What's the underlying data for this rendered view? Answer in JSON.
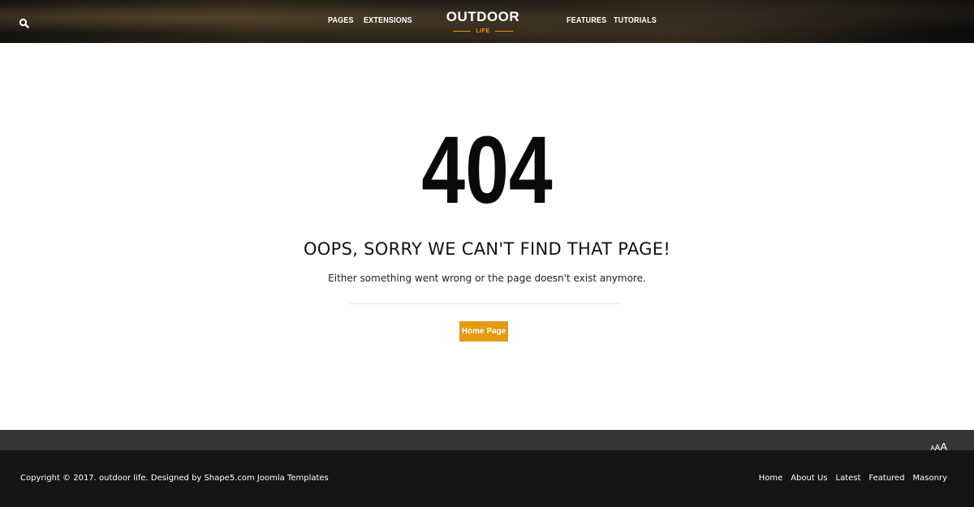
{
  "header": {
    "nav_left": [
      "PAGES",
      "EXTENSIONS"
    ],
    "nav_right": [
      "FEATURES",
      "TUTORIALS"
    ],
    "logo": {
      "main": "OUTDOOR",
      "sub": "LIFE"
    }
  },
  "error": {
    "code": "404",
    "title": "OOPS, SORRY WE CAN'T FIND THAT PAGE!",
    "description": "Either something went wrong or the page doesn't exist anymore.",
    "button_label": "Home Page"
  },
  "footer": {
    "font_resizer": [
      "A",
      "A",
      "A"
    ],
    "copyright": "Copyright © 2017. outdoor life. Designed by Shape5.com Joomla Templates",
    "links": [
      "Home",
      "About Us",
      "Latest",
      "Featured",
      "Masonry"
    ]
  },
  "colors": {
    "accent": "#e39b0f",
    "footer_top": "#353535",
    "footer_bottom": "#141414"
  },
  "icons": {
    "search": "search-icon"
  }
}
